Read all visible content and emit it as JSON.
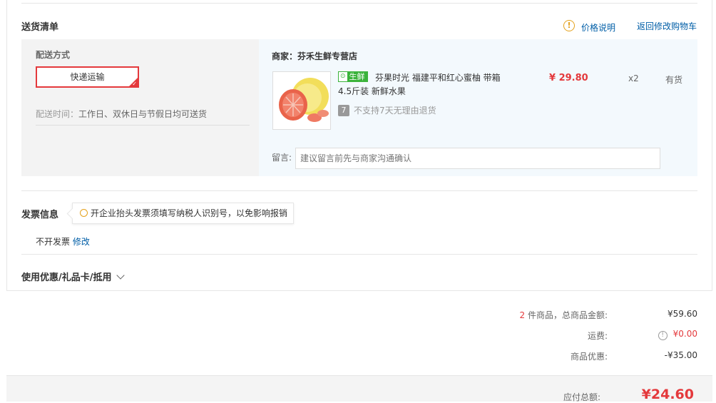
{
  "delivery": {
    "title": "送货清单",
    "price_info_link": "价格说明",
    "back_to_cart_link": "返回修改购物车",
    "shipping_method_label": "配送方式",
    "shipping_option": "快递运输",
    "delivery_time_label": "配送时间：",
    "delivery_time_value": "工作日、双休日与节假日均可送货"
  },
  "order": {
    "merchant_label": "商家：",
    "merchant_name": "芬禾生鲜专营店",
    "product_tag": "生鲜",
    "product_name": "芬果时光 福建平和红心蜜柚 带箱4.5斤装 新鲜水果",
    "price": "¥ 29.80",
    "quantity": "x2",
    "stock": "有货",
    "no_return_icon": "7",
    "no_return_text": "不支持7天无理由退货",
    "message_label": "留言:",
    "message_placeholder": "建议留言前先与商家沟通确认"
  },
  "invoice": {
    "title": "发票信息",
    "tip": "开企业抬头发票须填写纳税人识别号，以免影响报销",
    "value": "不开发票",
    "edit_link": "修改"
  },
  "coupon": {
    "label": "使用优惠/礼品卡/抵用"
  },
  "summary": {
    "item_count": "2",
    "item_count_suffix": "件商品，总商品金额:",
    "goods_amount": "¥59.60",
    "shipping_label": "运费:",
    "shipping_value": "¥0.00",
    "discount_label": "商品优惠:",
    "discount_value": "-¥35.00",
    "total_label": "应付总额:",
    "total_value": "¥24.60"
  },
  "colors": {
    "accent_red": "#e4393c",
    "link_blue": "#005ea7",
    "fresh_green": "#3bb33b",
    "warn_orange": "#e4a11b"
  },
  "icons": [
    "info-circle-icon",
    "lightbulb-icon",
    "chevron-down-icon",
    "no-return-7-icon",
    "fresh-tag-icon",
    "check-corner-icon"
  ]
}
